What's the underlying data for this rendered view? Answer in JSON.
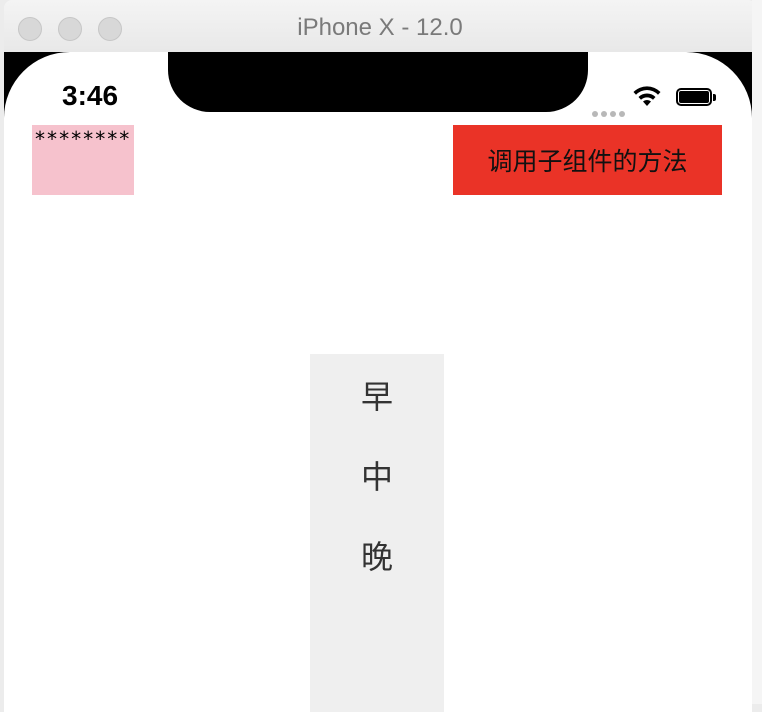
{
  "window": {
    "title": "iPhone X - 12.0"
  },
  "status_bar": {
    "time": "3:46",
    "signal_icon": "signal-dots-icon",
    "wifi_icon": "wifi-icon",
    "battery_icon": "battery-icon"
  },
  "content": {
    "masked_text": "********",
    "call_button_label": "调用子组件的方法",
    "picker_items": [
      "早",
      "中",
      "晚"
    ]
  },
  "colors": {
    "pink_box": "#f6c2cd",
    "button_red": "#ea3327",
    "picker_bg": "#efefef"
  }
}
